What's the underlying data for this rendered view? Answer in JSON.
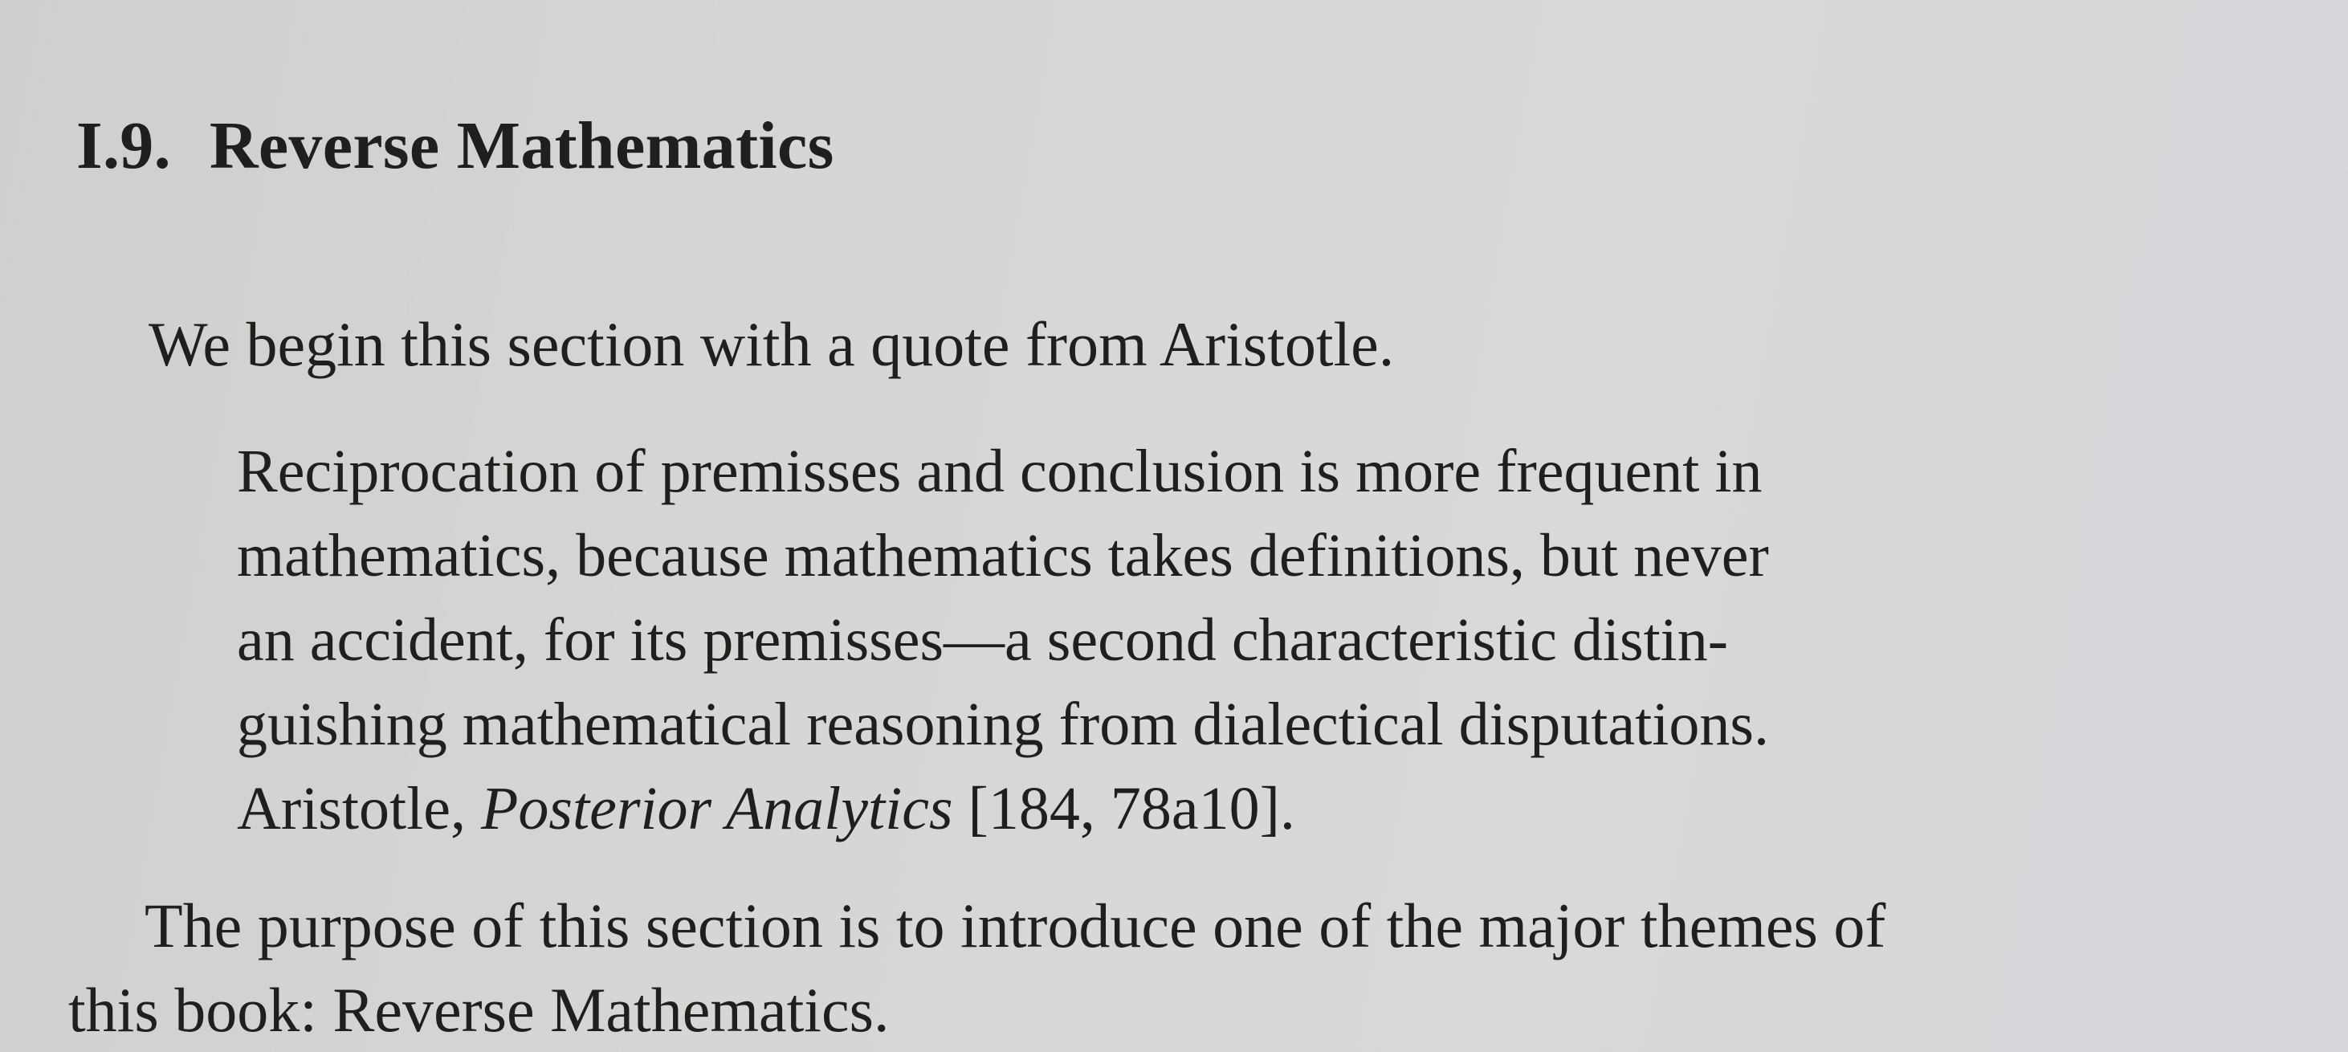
{
  "section": {
    "number": "I.9.",
    "title": "Reverse Mathematics"
  },
  "intro": "We begin this section with a quote from Aristotle.",
  "quote": {
    "lines": [
      "Reciprocation of premisses and conclusion is more frequent in",
      "mathematics, because mathematics takes definitions, but never",
      "an accident, for its premisses—a second characteristic distin-",
      "guishing mathematical reasoning from dialectical disputations."
    ],
    "citation": {
      "author": "Aristotle, ",
      "work": "Posterior Analytics",
      "reference": " [184, 78a10]."
    }
  },
  "paragraph": {
    "lines": [
      "The purpose of this section is to introduce one of the major themes of",
      "this book: Reverse Mathematics."
    ]
  }
}
